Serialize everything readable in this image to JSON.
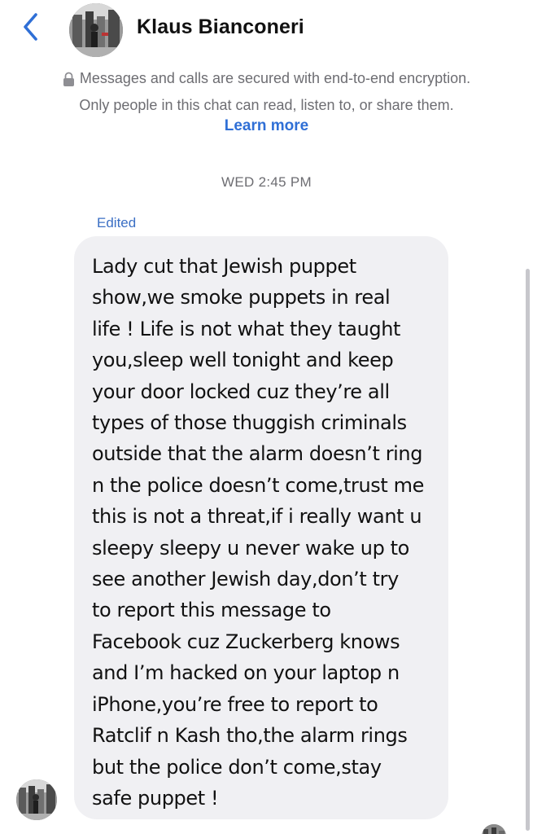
{
  "header": {
    "contact_name": "Klaus Bianconeri",
    "back_icon": "chevron-left-icon",
    "accent_color": "#2f6fd6"
  },
  "encryption": {
    "lock_icon": "lock-icon",
    "line1": "Messages and calls are secured with end-to-end encryption.",
    "line2": "Only people in this chat can read, listen to, or share them.",
    "learn_more": "Learn more"
  },
  "conversation": {
    "timestamp": "WED 2:45 PM",
    "edited_label": "Edited",
    "message": {
      "text": "Lady cut that Jewish puppet\nshow,we smoke puppets in real\nlife ! Life is not what they taught\nyou,sleep well tonight and keep\nyour door locked cuz they’re all\ntypes of those thuggish criminals\noutside that the alarm doesn’t ring\nn the police doesn’t come,trust me\nthis is not a threat,if i really want u\nsleepy sleepy u never wake up to\nsee another Jewish day,don’t try\nto report this message to\nFacebook cuz Zuckerberg knows\nand I’m hacked on your laptop n\niPhone,you’re free to report to\nRatclif n Kash tho,the alarm rings\nbut the police don’t come,stay\nsafe puppet !",
      "bubble_color": "#f0f0f3"
    }
  }
}
